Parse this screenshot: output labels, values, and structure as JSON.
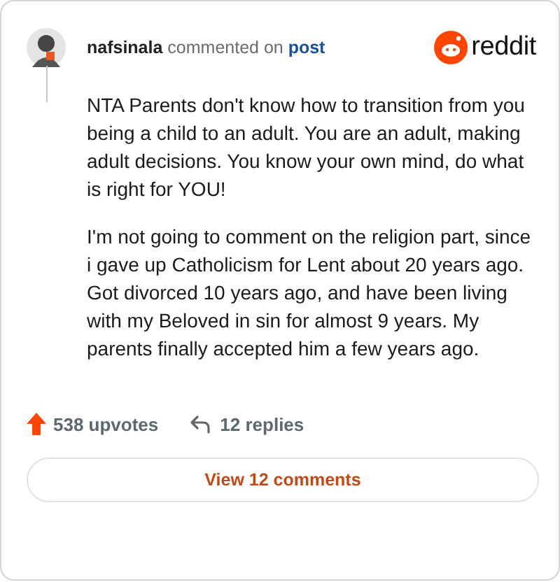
{
  "comment": {
    "author": "nafsinala",
    "action": "commented on",
    "target": "post"
  },
  "brand": {
    "name": "reddit"
  },
  "body": [
    "NTA Parents don't know how to transition from you being a child to an adult. You are an adult, making adult decisions. You know your own mind, do what is right for YOU!",
    "I'm not going to comment on the religion part, since i gave up Catholicism for Lent about 20 years ago. Got divorced 10 years ago, and have been living with my Beloved in sin for almost 9 years. My parents finally accepted him a few years ago."
  ],
  "stats": {
    "upvotes": "538 upvotes",
    "replies": "12 replies"
  },
  "button": "View 12 comments"
}
